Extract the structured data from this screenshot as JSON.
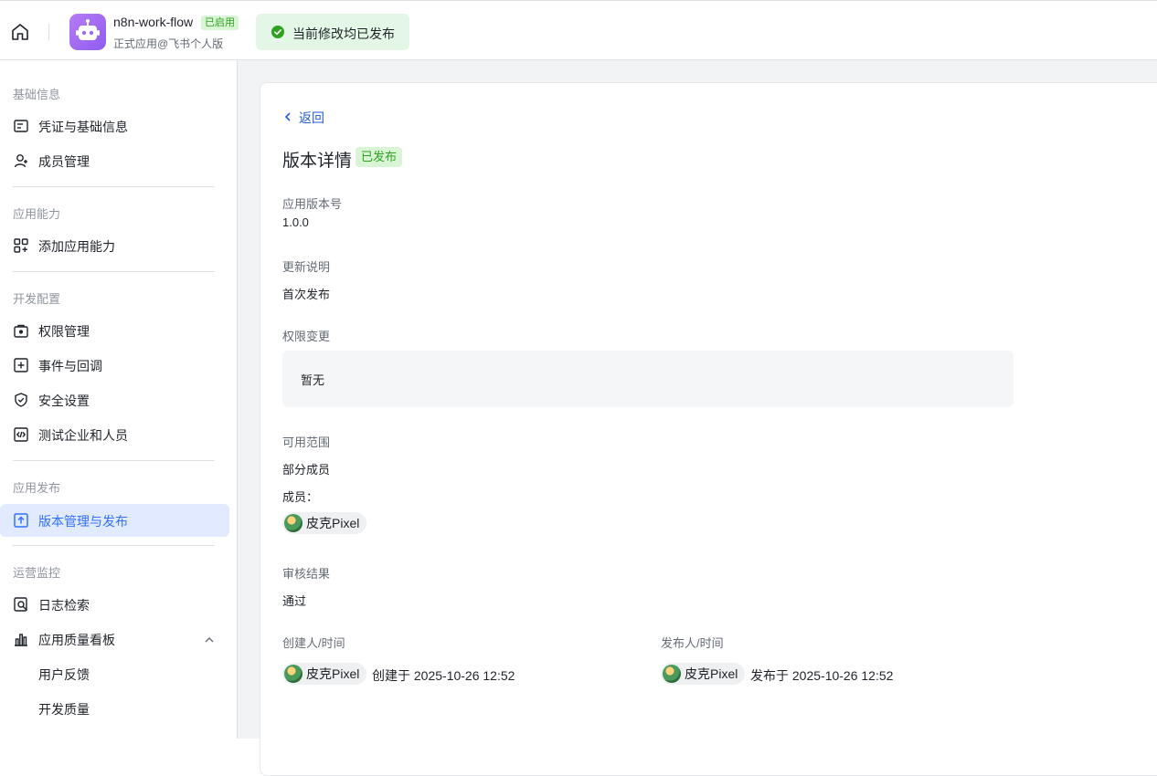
{
  "header": {
    "app_name": "n8n-work-flow",
    "enabled_badge": "已启用",
    "app_subtitle": "正式应用@飞书个人版",
    "publish_status": "当前修改均已发布"
  },
  "sidebar": {
    "sections": [
      {
        "title": "基础信息",
        "items": [
          {
            "label": "凭证与基础信息",
            "icon": "id-card-icon"
          },
          {
            "label": "成员管理",
            "icon": "user-add-icon"
          }
        ]
      },
      {
        "title": "应用能力",
        "items": [
          {
            "label": "添加应用能力",
            "icon": "app-grid-add-icon"
          }
        ]
      },
      {
        "title": "开发配置",
        "items": [
          {
            "label": "权限管理",
            "icon": "lock-box-icon"
          },
          {
            "label": "事件与回调",
            "icon": "event-plus-icon"
          },
          {
            "label": "安全设置",
            "icon": "shield-check-icon"
          },
          {
            "label": "测试企业和人员",
            "icon": "code-box-icon"
          }
        ]
      },
      {
        "title": "应用发布",
        "items": [
          {
            "label": "版本管理与发布",
            "icon": "upload-box-icon",
            "active": true
          }
        ]
      },
      {
        "title": "运营监控",
        "items": [
          {
            "label": "日志检索",
            "icon": "log-search-icon"
          },
          {
            "label": "应用质量看板",
            "icon": "bar-chart-icon"
          },
          {
            "label": "用户反馈"
          },
          {
            "label": "开发质量"
          }
        ]
      }
    ]
  },
  "detail": {
    "back_label": "返回",
    "title": "版本详情",
    "status": "已发布",
    "version_label": "应用版本号",
    "version_value": "1.0.0",
    "notes_label": "更新说明",
    "notes_value": "首次发布",
    "perm_label": "权限变更",
    "perm_value": "暂无",
    "scope_label": "可用范围",
    "scope_value": "部分成员",
    "members_label": "成员：",
    "member_name": "皮克Pixel",
    "review_label": "审核结果",
    "review_value": "通过",
    "creator_label": "创建人/时间",
    "creator_name": "皮克Pixel",
    "created_text": "创建于 2025-10-26 12:52",
    "publisher_label": "发布人/时间",
    "publisher_name": "皮克Pixel",
    "published_text": "发布于 2025-10-26 12:52"
  },
  "colors": {
    "accent": "#3370ff",
    "success": "#2ea121",
    "active_bg": "#e1eaff"
  }
}
